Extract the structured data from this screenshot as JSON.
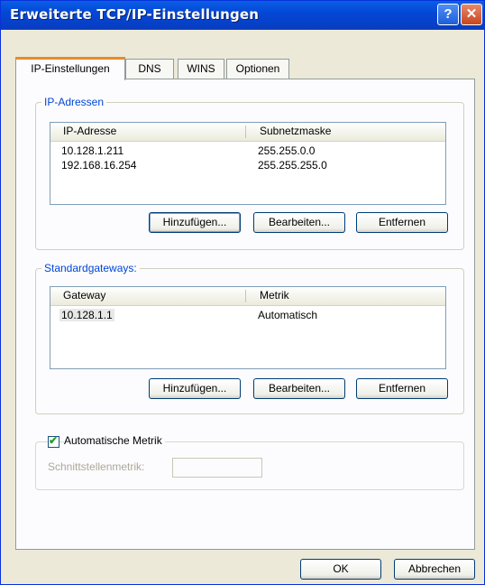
{
  "window": {
    "title": "Erweiterte TCP/IP-Einstellungen",
    "help_glyph": "?",
    "close_glyph": "✕"
  },
  "tabs": [
    {
      "label": "IP-Einstellungen",
      "active": true
    },
    {
      "label": "DNS",
      "active": false
    },
    {
      "label": "WINS",
      "active": false
    },
    {
      "label": "Optionen",
      "active": false
    }
  ],
  "ip_group": {
    "label": "IP-Adressen",
    "columns": [
      "IP-Adresse",
      "Subnetzmaske"
    ],
    "rows": [
      [
        "10.128.1.211",
        "255.255.0.0"
      ],
      [
        "192.168.16.254",
        "255.255.255.0"
      ]
    ],
    "buttons": {
      "add": "Hinzufügen...",
      "edit": "Bearbeiten...",
      "remove": "Entfernen"
    }
  },
  "gateway_group": {
    "label": "Standardgateways:",
    "columns": [
      "Gateway",
      "Metrik"
    ],
    "rows": [
      [
        "10.128.1.1",
        "Automatisch"
      ]
    ],
    "buttons": {
      "add": "Hinzufügen...",
      "edit": "Bearbeiten...",
      "remove": "Entfernen"
    }
  },
  "metric": {
    "checkbox_label": "Automatische Metrik",
    "checked": true,
    "check_glyph": "✔",
    "interface_label": "Schnittstellenmetrik:",
    "interface_value": ""
  },
  "footer": {
    "ok": "OK",
    "cancel": "Abbrechen"
  }
}
